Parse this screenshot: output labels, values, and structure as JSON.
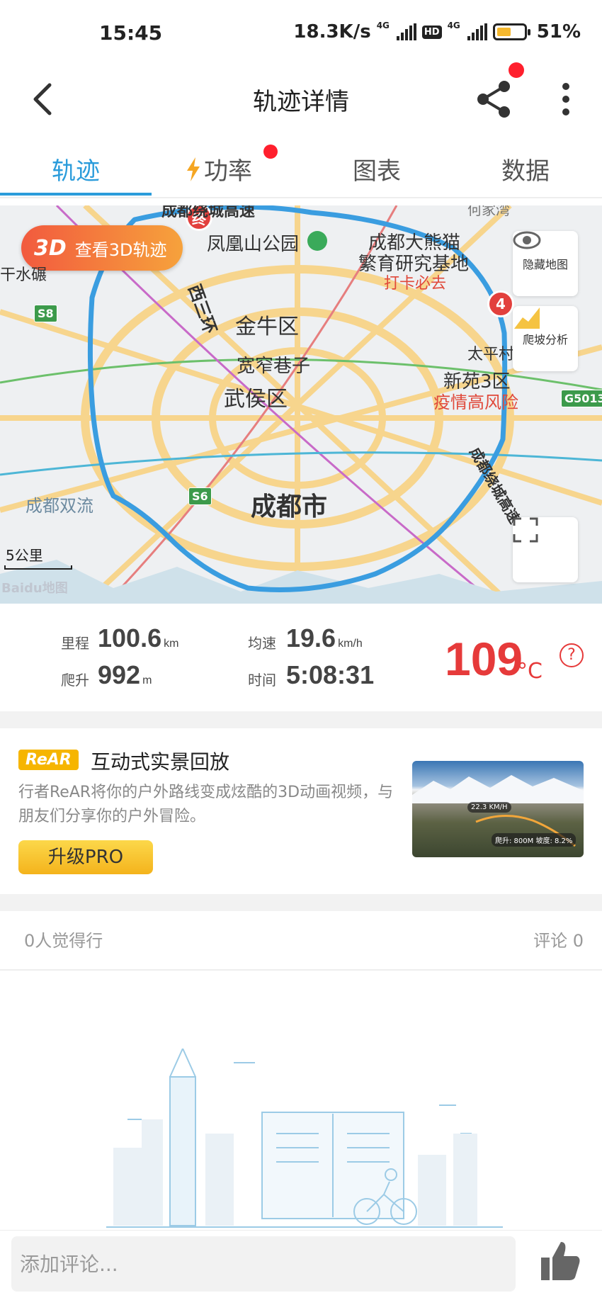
{
  "status_bar": {
    "time": "15:45",
    "net_speed": "18.3K/s",
    "net_type": "4G",
    "hd": "HD",
    "battery_percent": "51%",
    "battery_level": 0.51
  },
  "header": {
    "title": "轨迹详情",
    "share_badge_color": "#ff1f2d"
  },
  "tabs": [
    {
      "label": "轨迹",
      "active": true
    },
    {
      "label": "功率",
      "active": false,
      "has_dot": true,
      "icon": "lightning-icon"
    },
    {
      "label": "图表",
      "active": false
    },
    {
      "label": "数据",
      "active": false
    }
  ],
  "map": {
    "btn_3d_badge": "3D",
    "btn_3d_label": "查看3D轨迹",
    "hide_map_label": "隐藏地图",
    "climb_label": "爬坡分析",
    "end_marker": "终",
    "marker_4": "4",
    "scale": "5公里",
    "watermark": "Baidu地图",
    "roads": {
      "s8": "S8",
      "s6": "S6",
      "g5013": "G5013"
    },
    "labels": {
      "l1": "凤凰山公园",
      "l2": "成都大熊猫",
      "l3": "繁育研究基地",
      "l4": "打卡必去",
      "l5": "干水碾",
      "l6": "西三环",
      "l7": "金牛区",
      "l8": "宽窄巷子",
      "l9": "武侯区",
      "l10": "太平村",
      "l11": "新苑3区",
      "l12": "疫情高风险",
      "l13": "成都市",
      "l14": "成都双流",
      "l15": "成都绕城高速",
      "l16": "成都绕城高速",
      "l17": "何家湾"
    }
  },
  "stats": {
    "distance_label": "里程",
    "distance_value": "100.6",
    "distance_unit": "km",
    "avg_speed_label": "均速",
    "avg_speed_value": "19.6",
    "avg_speed_unit": "km/h",
    "climb_label": "爬升",
    "climb_value": "992",
    "climb_unit": "m",
    "time_label": "时间",
    "time_value": "5:08:31",
    "temperature_value": "109",
    "temperature_unit": "°C",
    "help_symbol": "?"
  },
  "promo": {
    "tag": "ReAR",
    "title": "互动式实景回放",
    "description": "行者ReAR将你的户外路线变成炫酷的3D动画视频，与朋友们分享你的户外冒险。",
    "button": "升级PRO",
    "image_speed": "22.3 KM/H",
    "image_info": "爬升: 800M 坡度: 8.2%"
  },
  "social": {
    "likes": "0人觉得行",
    "comments": "评论 0"
  },
  "comment_bar": {
    "placeholder": "添加评论..."
  },
  "colors": {
    "accent": "#2b9cdb",
    "track": "#3a9de0",
    "temp": "#e63a3a",
    "pro": "#f6b500"
  }
}
